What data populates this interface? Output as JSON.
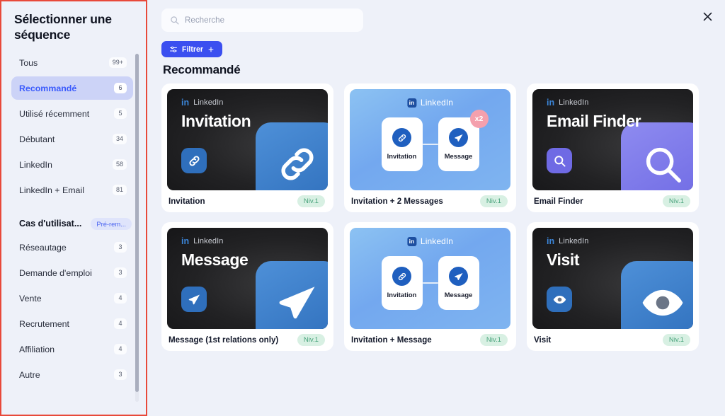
{
  "sidebar": {
    "title": "Sélectionner une séquence",
    "items": [
      {
        "label": "Tous",
        "count": "99+",
        "active": false
      },
      {
        "label": "Recommandé",
        "count": "6",
        "active": true
      },
      {
        "label": "Utilisé récemment",
        "count": "5",
        "active": false
      },
      {
        "label": "Débutant",
        "count": "34",
        "active": false
      },
      {
        "label": "LinkedIn",
        "count": "58",
        "active": false
      },
      {
        "label": "LinkedIn + Email",
        "count": "81",
        "active": false
      }
    ],
    "section": {
      "title": "Cas d'utilisat...",
      "pill": "Pré-rem..."
    },
    "use_cases": [
      {
        "label": "Réseautage",
        "count": "3"
      },
      {
        "label": "Demande d'emploi",
        "count": "3"
      },
      {
        "label": "Vente",
        "count": "4"
      },
      {
        "label": "Recrutement",
        "count": "4"
      },
      {
        "label": "Affiliation",
        "count": "4"
      },
      {
        "label": "Autre",
        "count": "3"
      }
    ]
  },
  "search": {
    "placeholder": "Recherche"
  },
  "toolbar": {
    "filter_label": "Filtrer"
  },
  "main": {
    "section_title": "Recommandé",
    "cards": [
      {
        "name": "Invitation",
        "level": "Niv.1",
        "style": "dark",
        "platform": "LinkedIn",
        "platform_mark": "in",
        "thumb_title": "Invitation",
        "icon": "link-icon",
        "accent": "#2f6fbc"
      },
      {
        "name": "Invitation + 2 Messages",
        "level": "Niv.1",
        "style": "blue",
        "platform": "LinkedIn",
        "platform_mark": "in",
        "badge": "x2",
        "nodes": [
          {
            "label": "Invitation",
            "icon": "link-icon"
          },
          {
            "label": "Message",
            "icon": "send-icon"
          }
        ]
      },
      {
        "name": "Email Finder",
        "level": "Niv.1",
        "style": "dark",
        "platform": "LinkedIn",
        "platform_mark": "in",
        "thumb_title": "Email Finder",
        "icon": "search-icon",
        "accent": "#6f6ae4"
      },
      {
        "name": "Message (1st relations only)",
        "level": "Niv.1",
        "style": "dark",
        "platform": "LinkedIn",
        "platform_mark": "in",
        "thumb_title": "Message",
        "icon": "send-icon",
        "accent": "#2f6fbc"
      },
      {
        "name": "Invitation + Message",
        "level": "Niv.1",
        "style": "blue",
        "platform": "LinkedIn",
        "platform_mark": "in",
        "nodes": [
          {
            "label": "Invitation",
            "icon": "link-icon"
          },
          {
            "label": "Message",
            "icon": "send-icon"
          }
        ]
      },
      {
        "name": "Visit",
        "level": "Niv.1",
        "style": "dark",
        "platform": "LinkedIn",
        "platform_mark": "in",
        "thumb_title": "Visit",
        "icon": "eye-icon",
        "accent": "#2f6fbc"
      }
    ]
  },
  "colors": {
    "background": "#eef1f9",
    "accent": "#3b4ff0",
    "active_item_bg": "#ccd3f7",
    "level_badge_bg": "#d8f0e3",
    "level_badge_fg": "#49a37c",
    "annotation_border": "#e8493a"
  }
}
